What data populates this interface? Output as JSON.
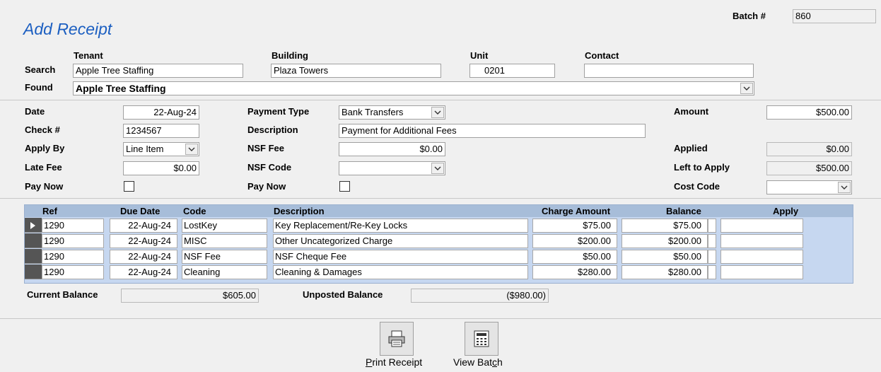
{
  "title": "Add Receipt",
  "batch": {
    "label": "Batch #",
    "value": "860"
  },
  "search": {
    "search_label": "Search",
    "found_label": "Found",
    "tenant_label": "Tenant",
    "building_label": "Building",
    "unit_label": "Unit",
    "contact_label": "Contact",
    "tenant_value": "Apple Tree Staffing",
    "building_value": "Plaza Towers",
    "unit_value": "0201",
    "contact_value": "",
    "found_value": "Apple Tree Staffing"
  },
  "form": {
    "date_label": "Date",
    "date_value": "22-Aug-24",
    "check_label": "Check #",
    "check_value": "1234567",
    "apply_by_label": "Apply By",
    "apply_by_value": "Line Item",
    "late_fee_label": "Late Fee",
    "late_fee_value": "$0.00",
    "pay_now_label": "Pay Now",
    "payment_type_label": "Payment Type",
    "payment_type_value": "Bank Transfers",
    "description_label": "Description",
    "description_value": "Payment for Additional Fees",
    "nsf_fee_label": "NSF Fee",
    "nsf_fee_value": "$0.00",
    "nsf_code_label": "NSF Code",
    "nsf_code_value": "",
    "pay_now2_label": "Pay Now",
    "amount_label": "Amount",
    "amount_value": "$500.00",
    "applied_label": "Applied",
    "applied_value": "$0.00",
    "left_label": "Left to Apply",
    "left_value": "$500.00",
    "cost_code_label": "Cost Code",
    "cost_code_value": ""
  },
  "grid": {
    "headers": [
      "Ref",
      "Due Date",
      "Code",
      "Description",
      "Charge Amount",
      "Balance",
      "Apply"
    ],
    "rows": [
      {
        "ref": "1290",
        "due": "22-Aug-24",
        "code": "LostKey",
        "desc": "Key Replacement/Re-Key Locks",
        "charge": "$75.00",
        "balance": "$75.00",
        "apply": ""
      },
      {
        "ref": "1290",
        "due": "22-Aug-24",
        "code": "MISC",
        "desc": "Other Uncategorized Charge",
        "charge": "$200.00",
        "balance": "$200.00",
        "apply": ""
      },
      {
        "ref": "1290",
        "due": "22-Aug-24",
        "code": "NSF Fee",
        "desc": "NSF Cheque Fee",
        "charge": "$50.00",
        "balance": "$50.00",
        "apply": ""
      },
      {
        "ref": "1290",
        "due": "22-Aug-24",
        "code": "Cleaning",
        "desc": "Cleaning & Damages",
        "charge": "$280.00",
        "balance": "$280.00",
        "apply": ""
      }
    ]
  },
  "balances": {
    "current_label": "Current Balance",
    "current_value": "$605.00",
    "unposted_label": "Unposted Balance",
    "unposted_value": "($980.00)"
  },
  "buttons": {
    "print_first": "P",
    "print_rest": "rint Receipt",
    "view_prefix": "View Bat",
    "view_ul": "c",
    "view_suffix": "h"
  },
  "icons": {
    "print": "printer-icon",
    "view": "calculator-icon"
  }
}
